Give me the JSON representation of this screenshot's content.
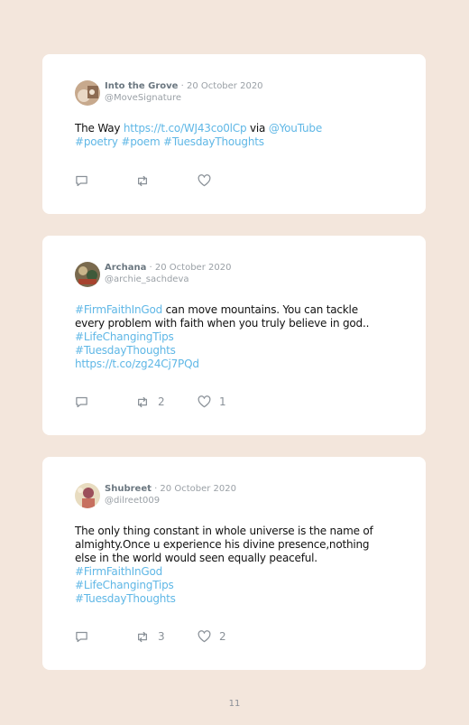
{
  "tweets": [
    {
      "name": "Into the Grove",
      "date": "· 20 October 2020",
      "handle": "@MoveSignature",
      "lines": [
        [
          {
            "t": "The Way ",
            "link": false
          },
          {
            "t": "https://t.co/WJ43co0lCp",
            "link": true
          },
          {
            "t": " via ",
            "link": false
          },
          {
            "t": "@YouTube",
            "link": true
          }
        ],
        [
          {
            "t": "#poetry #poem #TuesdayThoughts",
            "link": true
          }
        ]
      ],
      "retweets": "",
      "likes": "",
      "avatar_color": "#c7a98d"
    },
    {
      "name": "Archana",
      "date": "· 20 October 2020",
      "handle": "@archie_sachdeva",
      "lines": [
        [
          {
            "t": "#FirmFaithInGod",
            "link": true
          },
          {
            "t": " can move mountains. You can tackle",
            "link": false
          }
        ],
        [
          {
            "t": "every problem with faith when you truly believe in god..",
            "link": false
          }
        ],
        [
          {
            "t": "#LifeChangingTips",
            "link": true
          }
        ],
        [
          {
            "t": "#TuesdayThoughts",
            "link": true
          }
        ],
        [
          {
            "t": "https://t.co/zg24Cj7PQd",
            "link": true
          }
        ]
      ],
      "retweets": "2",
      "likes": "1",
      "avatar_color": "#7a6a4e"
    },
    {
      "name": "Shubreet",
      "date": "· 20 October 2020",
      "handle": "@dilreet009",
      "lines": [
        [
          {
            "t": "The only thing constant in whole universe is the name of",
            "link": false
          }
        ],
        [
          {
            "t": "almighty.Once u experience his divine presence,nothing",
            "link": false
          }
        ],
        [
          {
            "t": "else in the world would seen equally peaceful.",
            "link": false
          }
        ],
        [
          {
            "t": "#FirmFaithInGod",
            "link": true
          }
        ],
        [
          {
            "t": "#LifeChangingTips",
            "link": true
          }
        ],
        [
          {
            "t": "#TuesdayThoughts",
            "link": true
          }
        ]
      ],
      "retweets": "3",
      "likes": "2",
      "avatar_color": "#e8dcc0"
    }
  ],
  "page_number": "11",
  "colors": {
    "background": "#f3e6dc",
    "link": "#5fb7e6",
    "icon": "#8a9198"
  },
  "icons": {
    "reply": "reply-icon",
    "retweet": "retweet-icon",
    "like": "heart-icon"
  }
}
